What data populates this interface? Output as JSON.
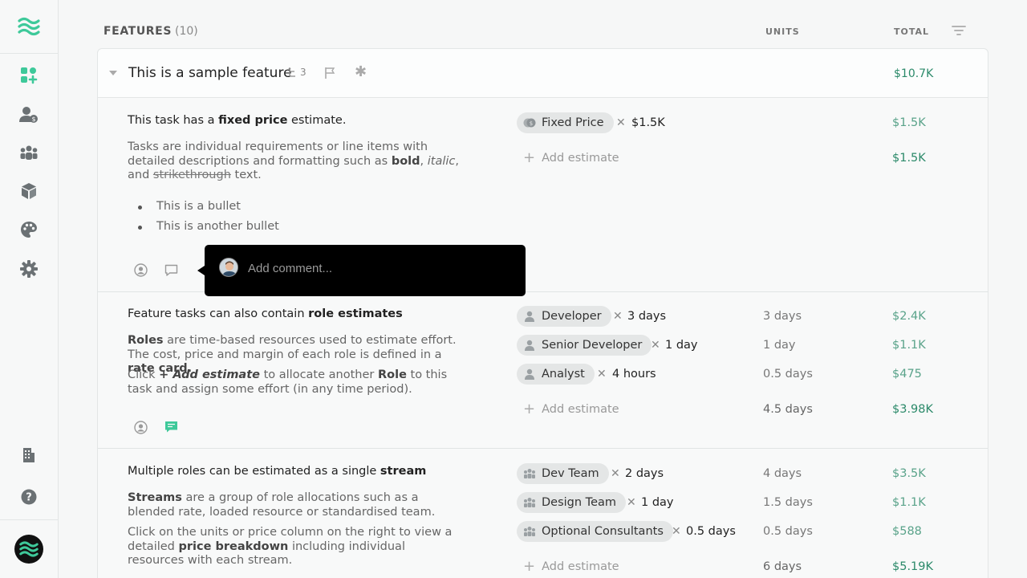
{
  "colors": {
    "accent": "#3ec99a",
    "price": "#5aa38a",
    "total": "#2c8a6a"
  },
  "header": {
    "title": "FEATURES",
    "count": "(10)",
    "units_col": "UNITS",
    "total_col": "TOTAL"
  },
  "feature": {
    "title": "This is a sample feature",
    "subtask_count": "3",
    "total": "$10.7K"
  },
  "task1": {
    "title_pre": "This task has a ",
    "title_bold": "fixed price",
    "title_post": " estimate.",
    "desc": {
      "p1": "Tasks are individual requirements or line items with detailed descriptions and formatting such as ",
      "bold": "bold",
      "comma1": ", ",
      "italic": "italic",
      "and": ", and ",
      "strike": "strikethrough",
      "end": " text."
    },
    "bullets": [
      "This is a bullet",
      "This is another bullet"
    ],
    "estimates": [
      {
        "label": "Fixed Price",
        "qty": "$1.5K",
        "price": "$1.5K"
      }
    ],
    "add_estimate": "Add estimate",
    "total_price": "$1.5K"
  },
  "comment": {
    "placeholder": "Add comment..."
  },
  "task2": {
    "title_pre": "Feature tasks can also contain ",
    "title_bold": "role estimates",
    "p1_bold": "Roles",
    "p1": " are time-based resources used to estimate effort. The cost, price and margin of each role is defined in a ",
    "p1_bold2": "rate card.",
    "p2_pre": "Click ",
    "p2_bi": "+ Add estimate",
    "p2_mid": " to allocate another ",
    "p2_bold": "Role",
    "p2_post": " to this task and assign some effort (in any time period).",
    "estimates": [
      {
        "label": "Developer",
        "qty": "3 days",
        "units": "3 days",
        "price": "$2.4K"
      },
      {
        "label": "Senior Developer",
        "qty": "1 day",
        "units": "1 day",
        "price": "$1.1K"
      },
      {
        "label": "Analyst",
        "qty": "4 hours",
        "units": "0.5 days",
        "price": "$475"
      }
    ],
    "add_estimate": "Add estimate",
    "total_units": "4.5 days",
    "total_price": "$3.98K"
  },
  "task3": {
    "title_pre": "Multiple roles can be estimated as a single ",
    "title_bold": "stream",
    "p1_bold": "Streams",
    "p1": " are a group of role allocations such as a blended rate, loaded resource or standardised team.",
    "p2_pre": "Click on the units or price column on the right to view a detailed ",
    "p2_bold": "price breakdown",
    "p2_post": " including individual resources with each stream.",
    "estimates": [
      {
        "label": "Dev Team",
        "qty": "2 days",
        "units": "4 days",
        "price": "$3.5K"
      },
      {
        "label": "Design Team",
        "qty": "1 day",
        "units": "1.5 days",
        "price": "$1.1K"
      },
      {
        "label": "Optional Consultants",
        "qty": "0.5 days",
        "units": "0.5 days",
        "price": "$588"
      }
    ],
    "add_estimate": "Add estimate",
    "total_units": "6 days",
    "total_price": "$5.19K"
  }
}
